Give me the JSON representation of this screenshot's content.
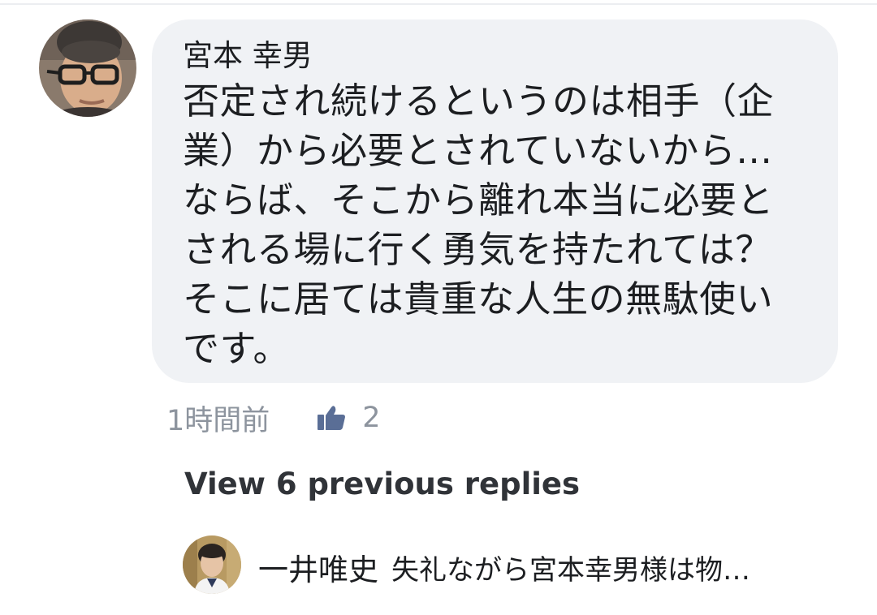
{
  "comment": {
    "author": "宮本 幸男",
    "text": "否定され続けるというのは相手（企\n業）から必要とされていないから…\nならば、そこから離れ本当に必要と\nされる場に行く勇気を持たれては？\nそこに居ては貴重な人生の無駄使い\nです。",
    "timestamp": "1時間前",
    "like_count": "2",
    "avatar_icon": "user-avatar-icon",
    "like_icon": "thumbs-up-icon"
  },
  "replies": {
    "view_previous_label": "View 6 previous replies",
    "latest": {
      "author": "一井唯史",
      "preview": "失礼ながら宮本幸男様は物…",
      "avatar_icon": "user-avatar-icon"
    }
  },
  "colors": {
    "bubble_bg": "#f0f2f5",
    "text_primary": "#1c1e21",
    "text_secondary": "#8d949e",
    "link_text": "#303338"
  }
}
